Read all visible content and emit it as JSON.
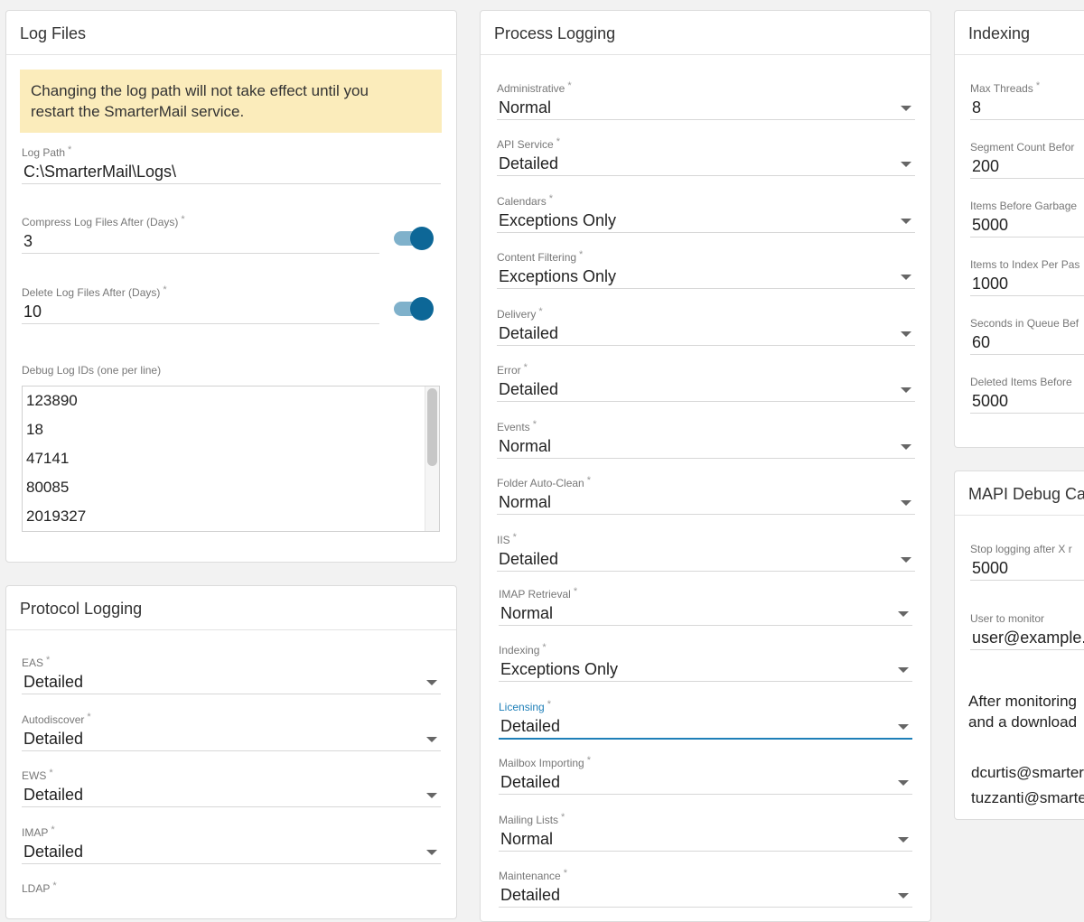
{
  "log_files": {
    "title": "Log Files",
    "warning_line1": "Changing the log path will not take effect until you",
    "warning_line2": "restart the SmarterMail service.",
    "log_path": {
      "label": "Log Path",
      "value": "C:\\SmarterMail\\Logs\\"
    },
    "compress": {
      "label": "Compress Log Files After (Days)",
      "value": "3",
      "enabled": true
    },
    "delete": {
      "label": "Delete Log Files After (Days)",
      "value": "10",
      "enabled": true
    },
    "debug_ids": {
      "label": "Debug Log IDs (one per line)",
      "lines": [
        "123890",
        "18",
        "47141",
        "80085",
        "2019327"
      ]
    }
  },
  "protocol_logging": {
    "title": "Protocol Logging",
    "fields": [
      {
        "label": "EAS",
        "value": "Detailed"
      },
      {
        "label": "Autodiscover",
        "value": "Detailed"
      },
      {
        "label": "EWS",
        "value": "Detailed"
      },
      {
        "label": "IMAP",
        "value": "Detailed"
      },
      {
        "label": "LDAP",
        "value": ""
      }
    ]
  },
  "process_logging": {
    "title": "Process Logging",
    "fields": [
      {
        "label": "Administrative",
        "value": "Normal"
      },
      {
        "label": "API Service",
        "value": "Detailed"
      },
      {
        "label": "Calendars",
        "value": "Exceptions Only"
      },
      {
        "label": "Content Filtering",
        "value": "Exceptions Only"
      },
      {
        "label": "Delivery",
        "value": "Detailed"
      },
      {
        "label": "Error",
        "value": "Detailed"
      },
      {
        "label": "Events",
        "value": "Normal"
      },
      {
        "label": "Folder Auto-Clean",
        "value": "Normal"
      },
      {
        "label": "IIS",
        "value": "Detailed"
      },
      {
        "label": "IMAP Retrieval",
        "value": "Normal"
      },
      {
        "label": "Indexing",
        "value": "Exceptions Only"
      },
      {
        "label": "Licensing",
        "value": "Detailed"
      },
      {
        "label": "Mailbox Importing",
        "value": "Detailed"
      },
      {
        "label": "Mailing Lists",
        "value": "Normal"
      },
      {
        "label": "Maintenance",
        "value": "Detailed"
      }
    ]
  },
  "indexing": {
    "title": "Indexing",
    "fields": [
      {
        "label": "Max Threads",
        "value": "8"
      },
      {
        "label": "Segment Count Befor",
        "value": "200"
      },
      {
        "label": "Items Before Garbage",
        "value": "5000"
      },
      {
        "label": "Items to Index Per Pas",
        "value": "1000"
      },
      {
        "label": "Seconds in Queue Bef",
        "value": "60"
      },
      {
        "label": "Deleted Items Before",
        "value": "5000"
      }
    ]
  },
  "mapi_debug": {
    "title": "MAPI Debug Cap",
    "stop_logging": {
      "label": "Stop logging after X r",
      "value": "5000"
    },
    "user_monitor": {
      "label": "User to monitor",
      "value": "user@example.c"
    },
    "note_line1": "After monitoring",
    "note_line2": "and a download",
    "emails": [
      "dcurtis@smarter",
      "tuzzanti@smarte"
    ]
  },
  "colors": {
    "accent": "#1e7fb8",
    "toggle_on": "#0d6797",
    "warning_bg": "#fbecbb"
  }
}
